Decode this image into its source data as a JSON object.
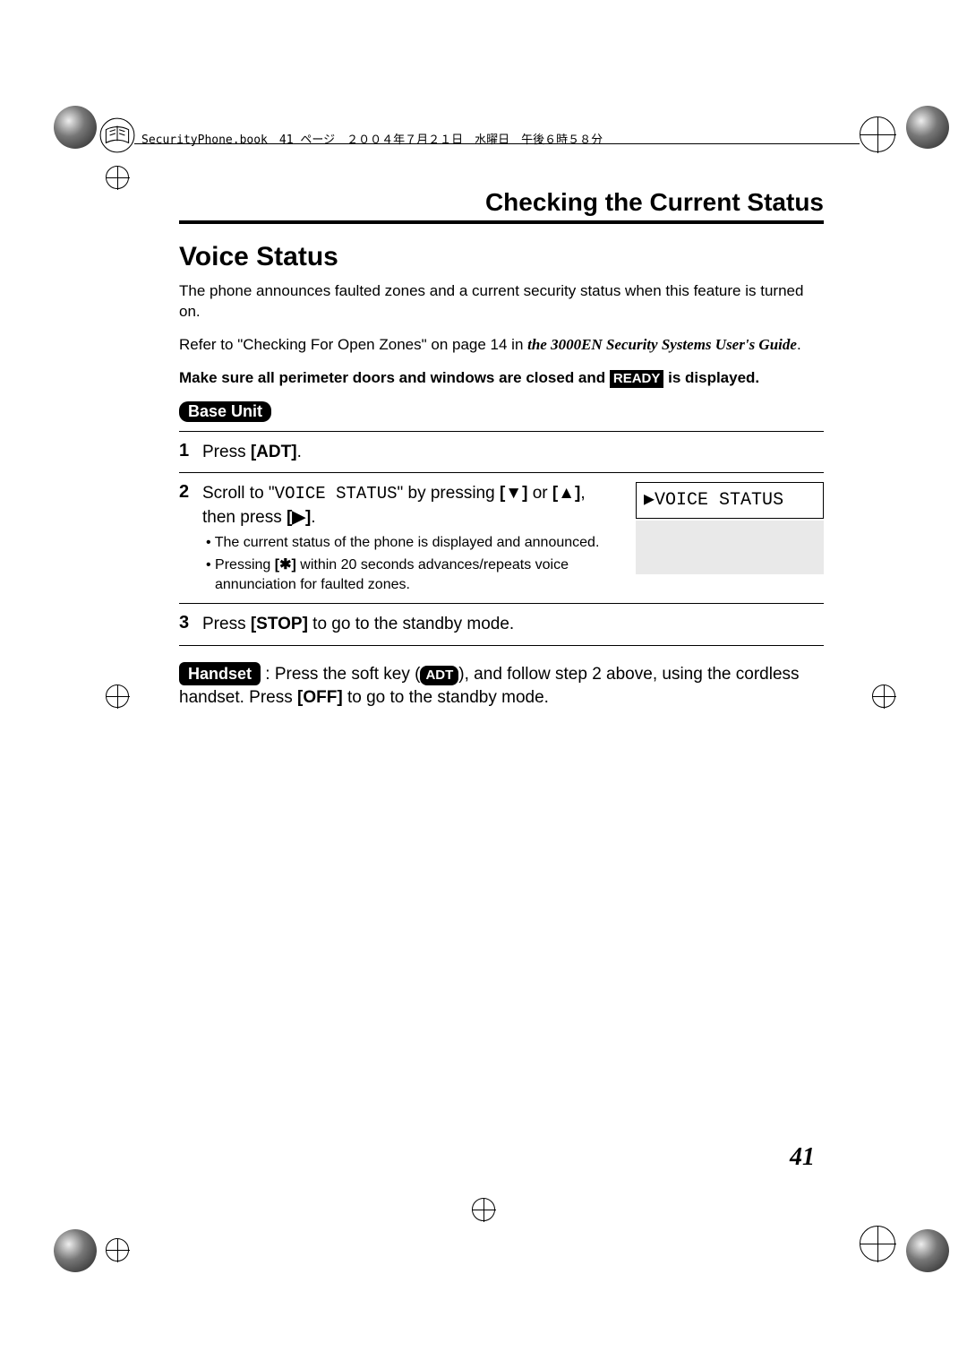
{
  "header_text": "SecurityPhone.book　41 ページ　２００４年７月２１日　水曜日　午後６時５８分",
  "chapter_title": "Checking the Current Status",
  "section_title": "Voice Status",
  "intro_p": "The phone announces faulted zones and a current security status when this feature is turned on.",
  "refer_prefix": "Refer to \"Checking For Open Zones\" on page 14 in ",
  "refer_doc_title": "the 3000EN Security Systems User's Guide",
  "refer_period": ".",
  "make_sure_prefix": "Make sure all perimeter doors and windows are closed and ",
  "ready_label": "READY",
  "make_sure_suffix": " is displayed.",
  "base_unit_label": "Base Unit",
  "step1_prefix": "Press ",
  "adt_button": "[ADT]",
  "step1_period": ".",
  "step2_prefix": "Scroll to \"",
  "step2_mono": "VOICE STATUS",
  "step2_mid1": "\" by pressing ",
  "down_btn": "[▼]",
  "step2_or": " or ",
  "up_btn": "[▲]",
  "step2_then": ", then press ",
  "right_btn": "[▶]",
  "step2_period": ".",
  "step2_bullet1": "• The current status of the phone is displayed and announced.",
  "step2_bullet2_prefix": "• Pressing ",
  "star_btn": "[✱]",
  "step2_bullet2_suffix": " within 20 seconds advances/repeats voice annunciation for faulted zones.",
  "lcd_text": "▶VOICE STATUS",
  "step3_prefix": "Press ",
  "stop_btn": "[STOP]",
  "step3_suffix": " to go to the standby mode.",
  "handset_label": "Handset",
  "handset_prefix": " : Press the soft key (",
  "adt_softkey": "ADT",
  "handset_mid": "), and follow step 2 above, using the cordless handset. Press ",
  "off_btn": "[OFF]",
  "handset_suffix": " to go to the standby mode.",
  "page_number": "41"
}
